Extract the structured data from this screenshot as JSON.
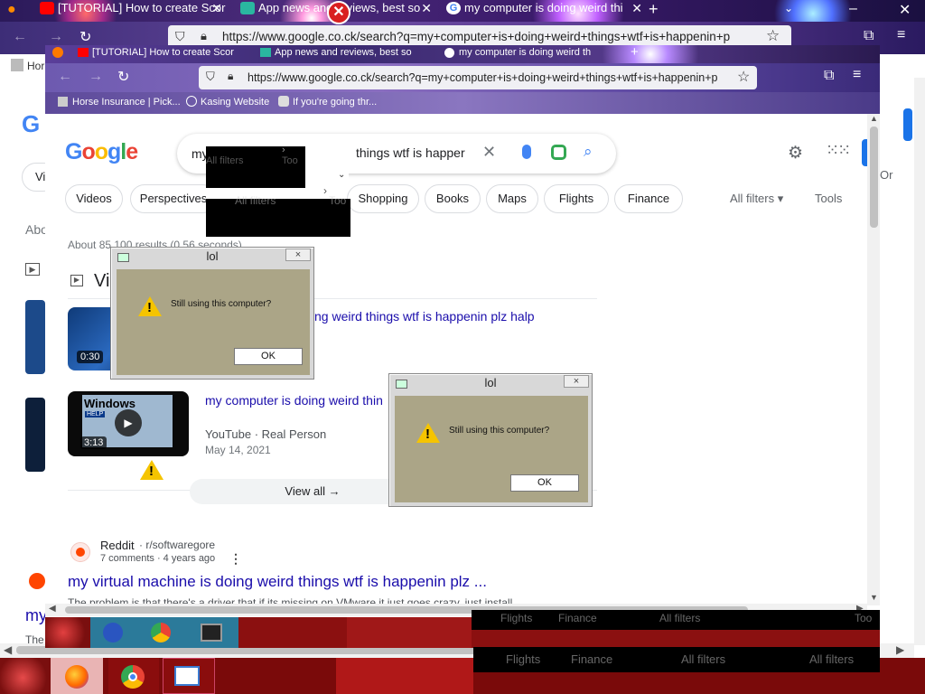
{
  "outer_browser": {
    "tabs": [
      {
        "title": "[TUTORIAL] How to create Scor",
        "icon": "youtube-icon"
      },
      {
        "title": "App news and reviews, best so",
        "icon": "app-icon"
      },
      {
        "title": "my computer is doing weird thi",
        "icon": "google-icon"
      }
    ],
    "new_tab": "+",
    "url": "https://www.google.co.ck/search?q=my+computer+is+doing+weird+things+wtf+is+happenin+p",
    "bookmark_fragment": "Hor"
  },
  "inner_browser": {
    "tabs": [
      {
        "title": "[TUTORIAL] How to create Scor"
      },
      {
        "title": "App news and reviews, best so"
      },
      {
        "title": "my computer is doing weird th"
      }
    ],
    "url": "https://www.google.co.ck/search?q=my+computer+is+doing+weird+things+wtf+is+happenin+p",
    "bookmarks": [
      "Horse Insurance | Pick...",
      "Kasing Website",
      "If you're going thr..."
    ]
  },
  "google": {
    "logo_letters": [
      "G",
      "o",
      "o",
      "g",
      "l",
      "e"
    ],
    "search_prefix": "my",
    "search_suffix": "things wtf is happer",
    "filters": [
      "Videos",
      "Perspectives",
      "Shopping",
      "Books",
      "Maps",
      "Flights",
      "Finance"
    ],
    "all_filters": "All filters",
    "tools": "Tools",
    "result_stats": "About 85,100 results (0.56 seconds)",
    "videos_heading": "Vi",
    "video1_title": "ng weird things wtf is happenin plz halp",
    "video1_duration": "0:30",
    "video2_title": "my computer is doing weird thin",
    "video2_duration": "3:13",
    "video2_source": "YouTube",
    "video2_author": "Real Person",
    "video2_date": "May 14, 2021",
    "video2_thumb_text": "Windows",
    "video2_thumb_sub": "HELP",
    "view_all": "View all",
    "reddit_site": "Reddit",
    "reddit_path": "r/softwaregore",
    "reddit_meta": "7 comments · 4 years ago",
    "reddit_title": "my virtual machine is doing weird things wtf is happenin plz ...",
    "reddit_snippet": "The problem is that there's a driver that if its missing on VMware it just goes crazy, just install",
    "ghost_filters": "All filters",
    "ghost_tools": "Too"
  },
  "outer_fragments": {
    "about": "Abo",
    "vi": "Vi",
    "my": "my",
    "the": "The",
    "right_cut": "Or"
  },
  "dialogs": [
    {
      "title": "lol",
      "message": "Still using this computer?",
      "ok": "OK"
    },
    {
      "title": "lol",
      "message": "Still using this computer?",
      "ok": "OK"
    }
  ],
  "dialog_close": "×",
  "ghost_strip": {
    "a": "Flights",
    "b": "Finance",
    "c": "All filters",
    "d": "Too"
  },
  "colors": {
    "google_blue": "#4285f4",
    "google_red": "#ea4335",
    "google_yellow": "#fbbc05",
    "google_green": "#34a853",
    "link": "#1a0dab"
  }
}
